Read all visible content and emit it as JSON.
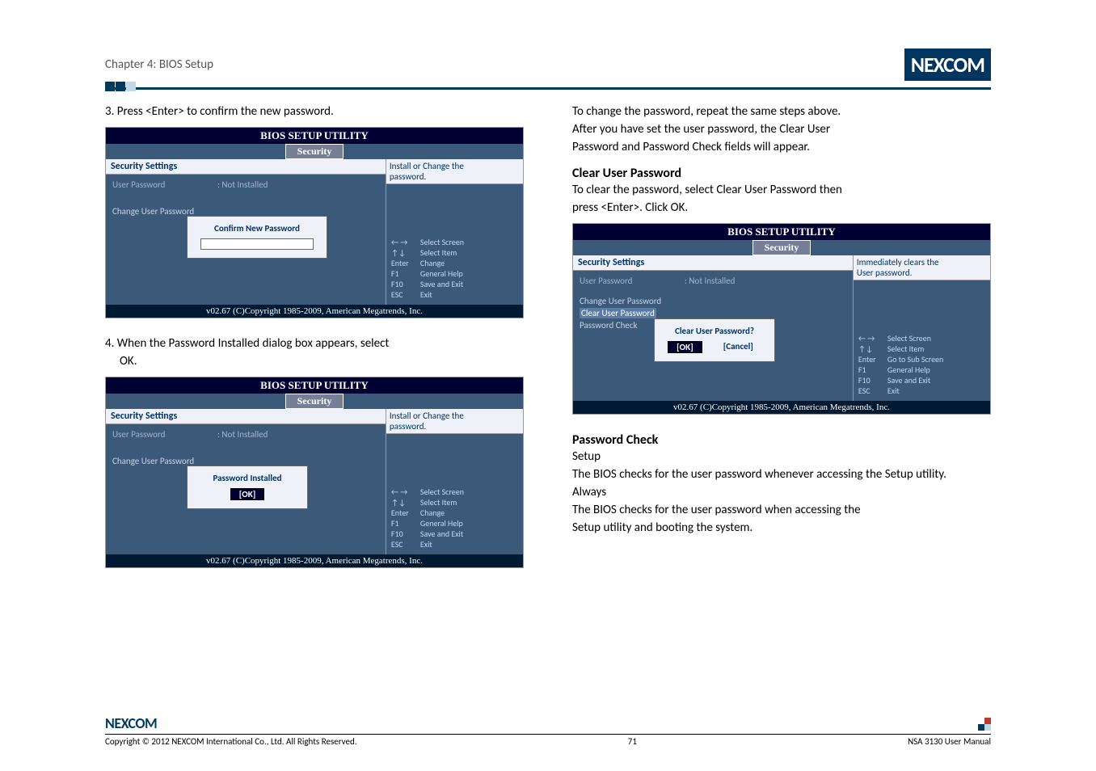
{
  "header": {
    "chapter": "Chapter 4: BIOS Setup",
    "logo": "NEXCOM"
  },
  "left": {
    "step3": "3. Press <Enter> to confirm the new password.",
    "step4": "4. When the Password Installed dialog box appears, select",
    "step4b": "OK."
  },
  "right": {
    "p1": "To change the password, repeat the same steps above.",
    "p2": "After you have set the user password, the Clear User",
    "p3": "Password and Password Check fields will appear.",
    "h_cup": "Clear User Password",
    "cup1": "To clear the password, select Clear User Password then",
    "cup2": "press <Enter>. Click OK.",
    "h_pc": "Password Check",
    "pc_setup": "Setup",
    "pc_setup_txt1": "The BIOS checks for the user password whenever accessing the Setup utility.",
    "pc_always": "Always",
    "pc_always_txt1": "The BIOS checks for the user password when accessing the",
    "pc_always_txt2": "Setup utility and booting the system."
  },
  "bios": {
    "title": "BIOS SETUP UTILITY",
    "tab": "Security",
    "section": "Security Settings",
    "user_pw_lbl": "User Password",
    "user_pw_val": ": Not Installed",
    "change_pw": "Change User Password",
    "clear_pw": "Clear User Password",
    "pw_check": "Password Check",
    "help1": "Install or Change the",
    "help1b": "password.",
    "help2": "Immediately clears the",
    "help2b": "User password.",
    "dlg_confirm": "Confirm New Password",
    "dlg_installed": "Password Installed",
    "dlg_clear": "Clear User Password?",
    "ok": "[OK]",
    "cancel": "[Cancel]",
    "keys": {
      "lr": "← →",
      "lr_d": "Select Screen",
      "ud": "↑↓",
      "ud_d": "Select Item",
      "ent": "Enter",
      "ent_d": "Change",
      "ent_d2": "Go to Sub Screen",
      "f1": "F1",
      "f1_d": "General Help",
      "f10": "F10",
      "f10_d": "Save and Exit",
      "esc": "ESC",
      "esc_d": "Exit"
    },
    "footer": "v02.67 (C)Copyright 1985-2009, American Megatrends, Inc."
  },
  "pagefoot": {
    "logo": "NEXCOM",
    "copyright": "Copyright © 2012 NEXCOM International Co., Ltd. All Rights Reserved.",
    "page": "71",
    "manual": "NSA 3130 User Manual"
  }
}
